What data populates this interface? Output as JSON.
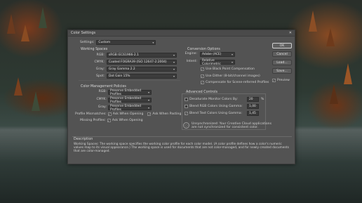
{
  "dialog": {
    "title": "Color Settings"
  },
  "settings": {
    "label": "Settings:",
    "value": "Custom"
  },
  "working_spaces": {
    "title": "Working Spaces",
    "rows": [
      {
        "label": "RGB:",
        "value": "sRGB IEC61966-2.1"
      },
      {
        "label": "CMYK:",
        "value": "Coated FOGRA39 (ISO 12647-2:2004)"
      },
      {
        "label": "Gray:",
        "value": "Gray Gamma 2.2"
      },
      {
        "label": "Spot:",
        "value": "Dot Gain 15%"
      }
    ]
  },
  "color_management": {
    "title": "Color Management Policies",
    "rows": [
      {
        "label": "RGB:",
        "value": "Preserve Embedded Profiles"
      },
      {
        "label": "CMYK:",
        "value": "Preserve Embedded Profiles"
      },
      {
        "label": "Gray:",
        "value": "Preserve Embedded Profiles"
      }
    ],
    "mismatches_label": "Profile Mismatches:",
    "ask_opening": "Ask When Opening",
    "ask_pasting": "Ask When Pasting",
    "missing_label": "Missing Profiles:",
    "missing_ask_opening": "Ask When Opening"
  },
  "conversion": {
    "title": "Conversion Options",
    "engine_label": "Engine:",
    "engine_value": "Adobe (ACE)",
    "intent_label": "Intent:",
    "intent_value": "Relative Colorimetric",
    "bpc": "Use Black Point Compensation",
    "dither": "Use Dither (8-bit/channel images)",
    "compensate": "Compensate for Scene-referred Profiles"
  },
  "advanced": {
    "title": "Advanced Controls",
    "desaturate": "Desaturate Monitor Colors By:",
    "desaturate_value": "20",
    "desaturate_unit": "%",
    "blend_rgb": "Blend RGB Colors Using Gamma:",
    "blend_rgb_value": "1,00",
    "blend_text": "Blend Text Colors Using Gamma:",
    "blend_text_value": "1,45",
    "unsync_line1": "Unsynchronized: Your Creative Cloud applications",
    "unsync_line2": "are not synchronized for consistent color."
  },
  "buttons": {
    "ok": "OK",
    "cancel": "Cancel",
    "load": "Load...",
    "save": "Save...",
    "preview": "Preview"
  },
  "description": {
    "title": "Description",
    "text": "Working Spaces:  The working space specifies the working color profile for each color model.  (A color profile defines how a color's numeric values map to its visual appearance.)  The working space is used for documents that are not color-managed, and for newly created documents that are color-managed."
  },
  "icons": {
    "close": "close-icon",
    "chevron": "chevron-down-icon",
    "check": "checkmark-icon",
    "sync": "sync-icon"
  }
}
